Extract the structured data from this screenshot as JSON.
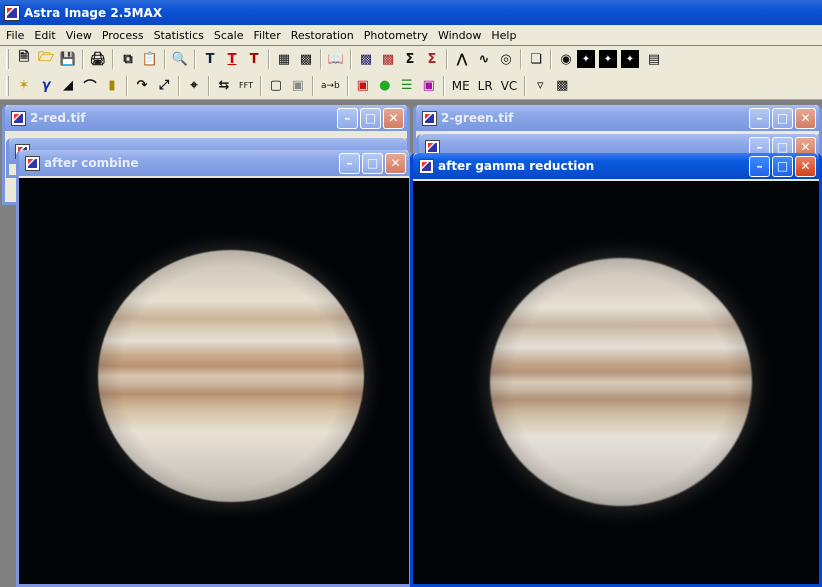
{
  "app": {
    "title": "Astra Image 2.5MAX"
  },
  "menu": [
    "File",
    "Edit",
    "View",
    "Process",
    "Statistics",
    "Scale",
    "Filter",
    "Restoration",
    "Photometry",
    "Window",
    "Help"
  ],
  "toolbar_text": {
    "me": "ME",
    "lr": "LR",
    "vc": "VC",
    "fft": "FFT",
    "ab": "a→b"
  },
  "windows": {
    "red": {
      "title": "2-red.tif"
    },
    "green": {
      "title": "2-green.tif"
    },
    "combine": {
      "title": "after combine"
    },
    "gamma": {
      "title": "after gamma reduction"
    }
  },
  "colors": {
    "titlebar_active": "#0a52d6",
    "titlebar_inactive": "#7b98e0",
    "canvas": "#020508",
    "menubar": "#ece9d8"
  }
}
